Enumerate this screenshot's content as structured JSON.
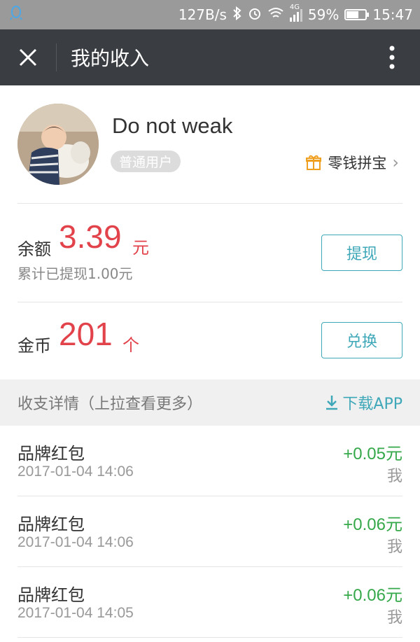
{
  "status_bar": {
    "speed": "127B/s",
    "network": "4G",
    "battery_percent_text": "59%",
    "battery_level": 0.59,
    "time": "15:47"
  },
  "titlebar": {
    "title": "我的收入"
  },
  "profile": {
    "username": "Do not weak",
    "badge": "普通用户",
    "treasure_label": "零钱拼宝",
    "treasure_chevron": "›"
  },
  "balance": {
    "label": "余额",
    "amount": "3.39",
    "unit": "元",
    "withdrawn_note": "累计已提现1.00元",
    "withdraw_button": "提现"
  },
  "coins": {
    "label": "金币",
    "amount": "201",
    "unit": "个",
    "exchange_button": "兑换"
  },
  "details": {
    "header": "收支详情（上拉查看更多）",
    "download_label": "下载APP"
  },
  "transactions": [
    {
      "name": "品牌红包",
      "time": "2017-01-04 14:06",
      "amount": "+0.05元",
      "who": "我"
    },
    {
      "name": "品牌红包",
      "time": "2017-01-04 14:06",
      "amount": "+0.06元",
      "who": "我"
    },
    {
      "name": "品牌红包",
      "time": "2017-01-04 14:05",
      "amount": "+0.06元",
      "who": "我"
    }
  ],
  "colors": {
    "accent": "#3ea7b8",
    "amount_red": "#e2434b",
    "income_green": "#35a84a",
    "titlebar": "#3a3d42"
  }
}
